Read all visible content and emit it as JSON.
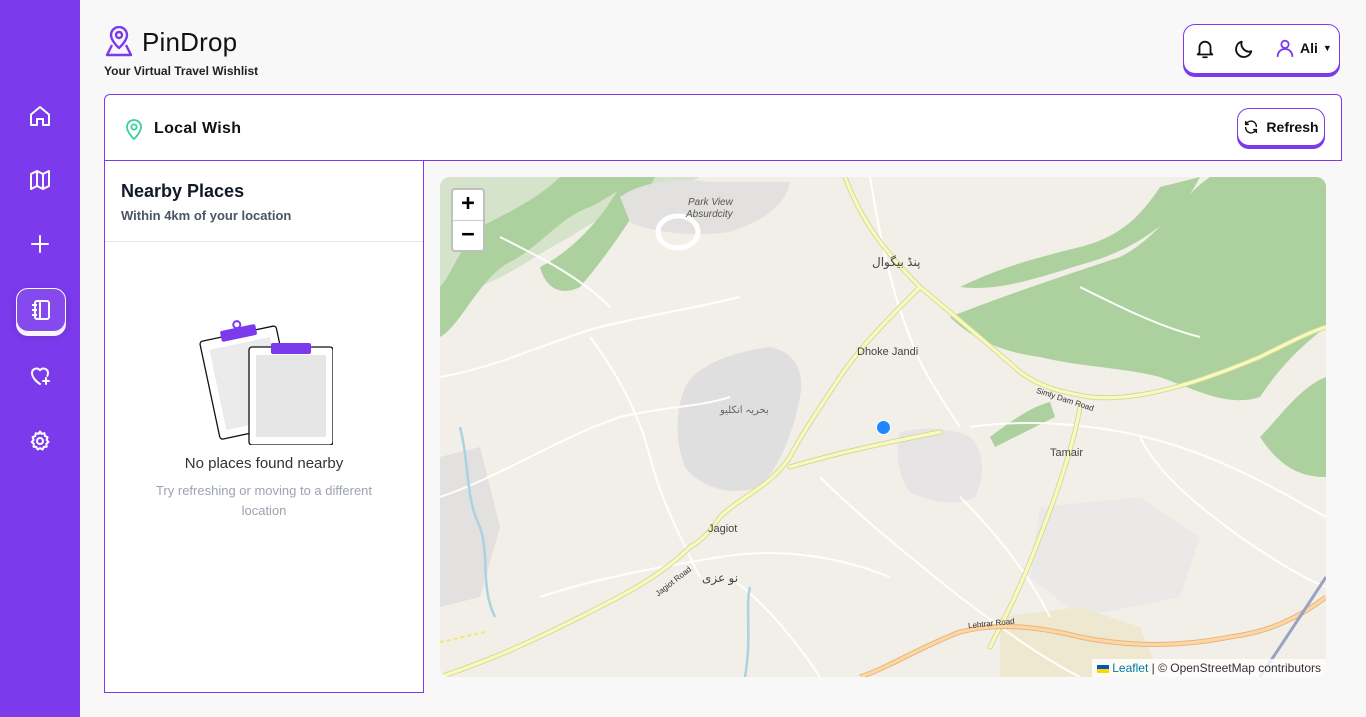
{
  "brand": {
    "title": "PinDrop",
    "subtitle": "Your Virtual Travel Wishlist",
    "icon": "user-location-pin-icon"
  },
  "sidebar": {
    "items": [
      {
        "name": "home",
        "icon": "home-icon"
      },
      {
        "name": "map",
        "icon": "map-icon"
      },
      {
        "name": "add",
        "icon": "plus-icon"
      },
      {
        "name": "local-wish",
        "icon": "notebook-icon",
        "active": true
      },
      {
        "name": "wishlist",
        "icon": "heart-plus-icon"
      },
      {
        "name": "settings",
        "icon": "gear-icon"
      }
    ]
  },
  "header": {
    "user_name": "Ali",
    "icons": [
      "bell-icon",
      "moon-icon",
      "user-icon"
    ]
  },
  "panel": {
    "title": "Local Wish",
    "refresh_label": "Refresh"
  },
  "nearby": {
    "title": "Nearby Places",
    "subtitle": "Within 4km of your location",
    "empty_title": "No places found nearby",
    "empty_subtitle": "Try refreshing or moving to a different location"
  },
  "map": {
    "zoom_in": "+",
    "zoom_out": "−",
    "attribution_link": "Leaflet",
    "attribution_text": "| © OpenStreetMap contributors",
    "labels": {
      "park_view_1": "Park View",
      "park_view_2": "Absurdcity",
      "pind_begwal": "پنڈ بیگوال",
      "dhoke_jandi": "Dhoke Jandi",
      "bahria": "بحریہ انکلیو",
      "tamair": "Tamair",
      "jagiot": "Jagiot",
      "nou_azri": "نو عزی",
      "simly_dam_road": "Simly Dam Road",
      "jagiot_road": "Jagiot Road",
      "lehtrar_road": "Lehtrar Road"
    }
  },
  "colors": {
    "accent": "#7c3aed",
    "map_bg": "#f2efe9",
    "forest": "#add19e",
    "main_road": "#f7fabf",
    "secondary_road": "#fcd6a4",
    "location_dot": "#1e88ff"
  }
}
